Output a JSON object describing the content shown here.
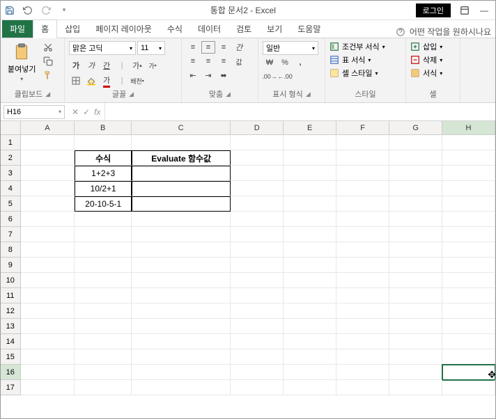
{
  "titlebar": {
    "title": "통합 문서2 - Excel",
    "login": "로그인"
  },
  "tabs": {
    "file": "파일",
    "home": "홈",
    "insert": "삽입",
    "layout": "페이지 레이아웃",
    "formulas": "수식",
    "data": "데이터",
    "review": "검토",
    "view": "보기",
    "help": "도움말",
    "tellme": "어떤 작업을 원하시나요"
  },
  "ribbon": {
    "clipboard": {
      "paste": "붙여넣기",
      "label": "클립보드"
    },
    "font": {
      "name": "맑은 고딕",
      "size": "11",
      "label": "글꼴"
    },
    "align": {
      "label": "맞춤",
      "wrap": "값"
    },
    "number": {
      "format": "일반",
      "label": "표시 형식"
    },
    "styles": {
      "cond": "조건부 서식",
      "table": "표 서식",
      "cell": "셀 스타일",
      "label": "스타일"
    },
    "cells": {
      "insert": "삽입",
      "delete": "삭제",
      "format": "서식",
      "label": "셀"
    }
  },
  "namebox": {
    "ref": "H16"
  },
  "columns": [
    "A",
    "B",
    "C",
    "D",
    "E",
    "F",
    "G",
    "H"
  ],
  "col_widths": {
    "A": 82,
    "B": 86,
    "C": 150,
    "D": 80,
    "E": 80,
    "F": 80,
    "G": 80,
    "H": 80
  },
  "active_col": "H",
  "active_row": 16,
  "row_count": 17,
  "sheet": {
    "B2": "수식",
    "C2": "Evaluate 함수값",
    "B3": "1+2+3",
    "B4": "10/2+1",
    "B5": "20-10-5-1"
  }
}
